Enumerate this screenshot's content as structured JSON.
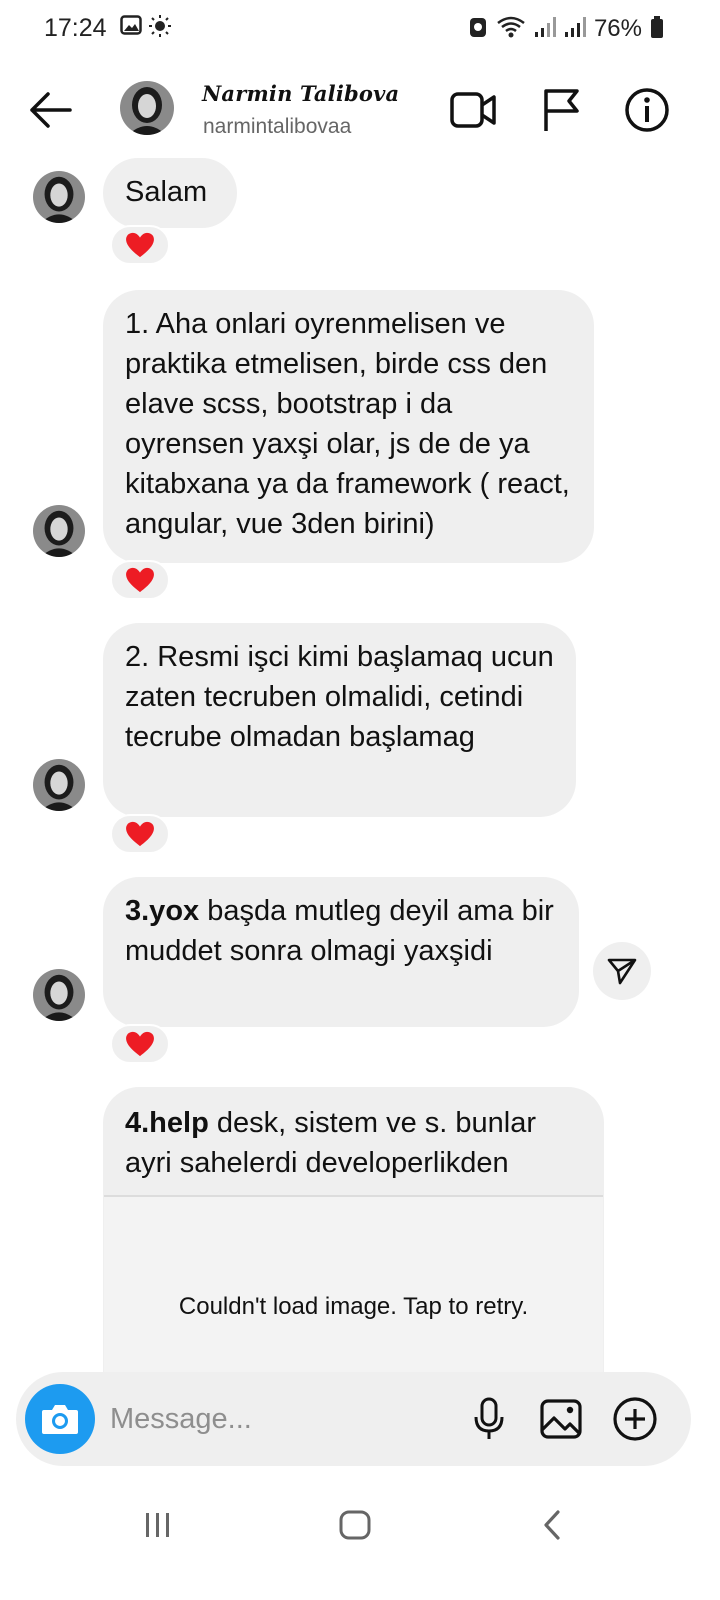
{
  "status_bar": {
    "time": "17:24",
    "battery": "76%"
  },
  "header": {
    "contact_name": "Narmin Talibova",
    "contact_handle": "narmintalibovaa",
    "icons": [
      "back-arrow-icon",
      "video-call-icon",
      "flag-icon",
      "info-icon"
    ]
  },
  "messages": [
    {
      "text": "Salam",
      "reaction": "❤️"
    },
    {
      "text": "1. Aha onlari oyrenmelisen ve praktika etmelisen, birde css den elave scss, bootstrap i da oyrensen yaxşi olar, js de de ya kitabxana ya da framework ( react, angular, vue 3den birini)",
      "reaction": "❤️"
    },
    {
      "text": "2. Resmi işci kimi başlamaq ucun zaten tecruben olmalidi, cetindi tecrube olmadan başlamag",
      "reaction": "❤️"
    },
    {
      "bold": "3.yox",
      "text": " başda mutleg deyil ama bir muddet sonra olmagi yaxşidi",
      "reaction": "❤️"
    },
    {
      "bold": "4.help",
      "text": " desk, sistem ve s. bunlar ayri sahelerdi developerlikden",
      "image_error": "Couldn't load image. Tap to retry."
    }
  ],
  "composer": {
    "placeholder": "Message..."
  },
  "colors": {
    "bubble": "#efefef",
    "camera_button": "#1d9bf0",
    "heart": "#ed1c24"
  }
}
